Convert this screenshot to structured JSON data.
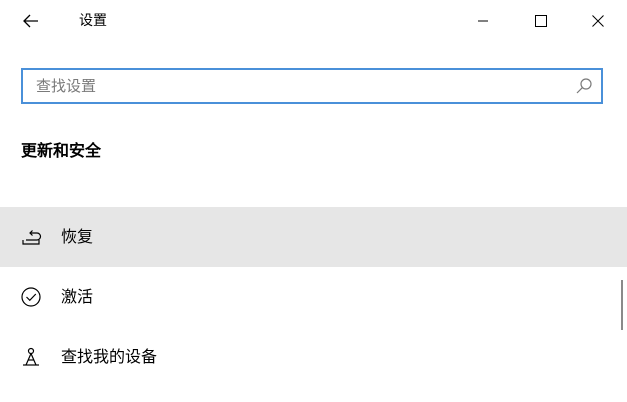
{
  "window": {
    "title": "设置"
  },
  "search": {
    "placeholder": "查找设置",
    "value": ""
  },
  "section": {
    "title": "更新和安全"
  },
  "nav": {
    "items": [
      {
        "label": "恢复",
        "icon": "recovery-icon",
        "selected": true
      },
      {
        "label": "激活",
        "icon": "activation-icon",
        "selected": false
      },
      {
        "label": "查找我的设备",
        "icon": "find-my-device-icon",
        "selected": false
      }
    ]
  },
  "colors": {
    "search_border": "#4a90d9",
    "selected_background": "#e6e6e6",
    "scrollbar": "#8a8a8a"
  }
}
